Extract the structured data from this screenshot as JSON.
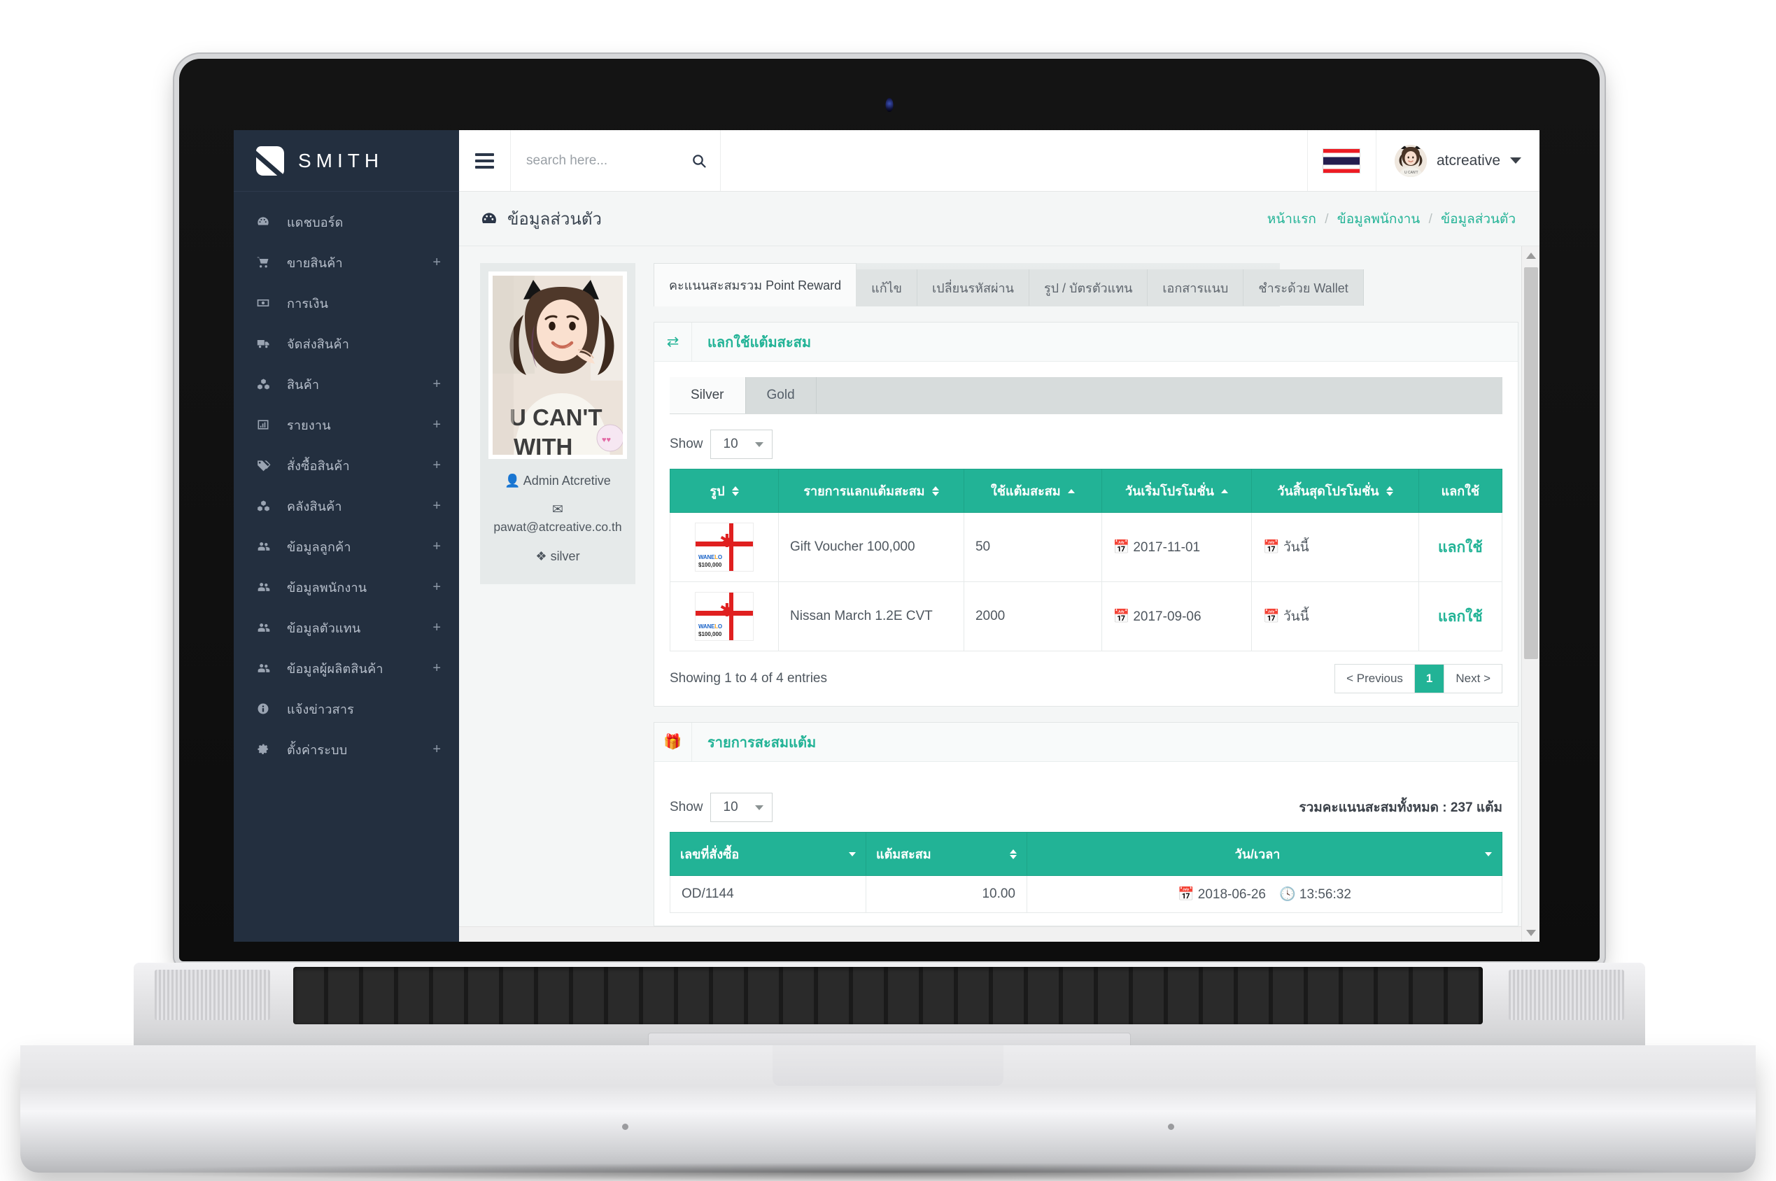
{
  "brand": {
    "name": "SMITH",
    "logo_icon": "smith-logo-icon"
  },
  "sidebar": {
    "items": [
      {
        "label": "แดชบอร์ด",
        "icon": "dashboard-icon",
        "expandable": false
      },
      {
        "label": "ขายสินค้า",
        "icon": "cart-icon",
        "expandable": true,
        "plus": "+"
      },
      {
        "label": "การเงิน",
        "icon": "money-icon",
        "expandable": false
      },
      {
        "label": "จัดส่งสินค้า",
        "icon": "truck-icon",
        "expandable": false
      },
      {
        "label": "สินค้า",
        "icon": "cubes-icon",
        "expandable": true,
        "plus": "+"
      },
      {
        "label": "รายงาน",
        "icon": "chart-bar-icon",
        "expandable": true,
        "plus": "+"
      },
      {
        "label": "สั่งซื้อสินค้า",
        "icon": "tags-icon",
        "expandable": true,
        "plus": "+"
      },
      {
        "label": "คลังสินค้า",
        "icon": "cubes-icon",
        "expandable": true,
        "plus": "+"
      },
      {
        "label": "ข้อมูลลูกค้า",
        "icon": "users-icon",
        "expandable": true,
        "plus": "+"
      },
      {
        "label": "ข้อมูลพนักงาน",
        "icon": "users-icon",
        "expandable": true,
        "plus": "+"
      },
      {
        "label": "ข้อมูลตัวแทน",
        "icon": "users-icon",
        "expandable": true,
        "plus": "+"
      },
      {
        "label": "ข้อมูลผู้ผลิตสินค้า",
        "icon": "users-icon",
        "expandable": true,
        "plus": "+"
      },
      {
        "label": "แจ้งข่าวสาร",
        "icon": "info-circle-icon",
        "expandable": false
      },
      {
        "label": "ตั้งค่าระบบ",
        "icon": "gear-icon",
        "expandable": true,
        "plus": "+"
      }
    ]
  },
  "topbar": {
    "hamburger_icon": "hamburger-icon",
    "search": {
      "placeholder": "search here...",
      "value": "",
      "icon": "search-icon"
    },
    "language_flag": "thailand-flag-icon",
    "user": {
      "name": "atcreative",
      "avatar_icon": "user-avatar",
      "caret_icon": "chevron-down-icon"
    }
  },
  "page": {
    "title": "ข้อมูลส่วนตัว",
    "title_icon": "dashboard-icon",
    "breadcrumb": [
      "หน้าแรก",
      "ข้อมูลพนักงาน",
      "ข้อมูลส่วนตัว"
    ],
    "breadcrumb_sep": "/"
  },
  "profile": {
    "photo_alt": "profile-photo",
    "name": "Admin Atcretive",
    "name_icon": "user-icon",
    "email": "pawat@atcreative.co.th",
    "email_icon": "envelope-icon",
    "rank": "silver",
    "rank_icon": "rank-icon"
  },
  "tabs": [
    {
      "label": "คะแนนสะสมรวม Point Reward",
      "active": true
    },
    {
      "label": "แก้ไข",
      "active": false
    },
    {
      "label": "เปลี่ยนรหัสผ่าน",
      "active": false
    },
    {
      "label": "รูป / บัตรตัวแทน",
      "active": false
    },
    {
      "label": "เอกสารแนบ",
      "active": false
    },
    {
      "label": "ชำระด้วย Wallet",
      "active": false
    }
  ],
  "redeem_panel": {
    "icon": "exchange-icon",
    "title": "แลกใช้แต้มสะสม",
    "subtabs": [
      {
        "label": "Silver",
        "active": true
      },
      {
        "label": "Gold",
        "active": false
      }
    ],
    "show_label": "Show",
    "show_value": "10",
    "columns": [
      {
        "label": "รูป",
        "sort": "both"
      },
      {
        "label": "รายการแลกแต้มสะสม",
        "sort": "both"
      },
      {
        "label": "ใช้แต้มสะสม",
        "sort": "up"
      },
      {
        "label": "วันเริ่มโปรโมชั่น",
        "sort": "up"
      },
      {
        "label": "วันสิ้นสุดโปรโมชั่น",
        "sort": "both"
      },
      {
        "label": "แลกใช้",
        "sort": "none"
      }
    ],
    "rows": [
      {
        "image_icon": "gift-voucher-thumb",
        "image_label_1": "WANELO",
        "image_label_2": "$100,000",
        "name": "Gift Voucher 100,000",
        "points": "50",
        "start_date": "2017-11-01",
        "end_date": "วันนี้",
        "action": "แลกใช้"
      },
      {
        "image_icon": "gift-voucher-thumb",
        "image_label_1": "WANELO",
        "image_label_2": "$100,000",
        "name": "Nissan March 1.2E CVT",
        "points": "2000",
        "start_date": "2017-09-06",
        "end_date": "วันนี้",
        "action": "แลกใช้"
      }
    ],
    "entries_info": "Showing 1 to 4 of 4 entries",
    "pagination": {
      "previous": "< Previous",
      "pages": [
        "1"
      ],
      "current": "1",
      "next": "Next >"
    }
  },
  "points_panel": {
    "icon": "gift-icon",
    "title": "รายการสะสมแต้ม",
    "show_label": "Show",
    "show_value": "10",
    "total_label": "รวมคะแนนสะสมทั้งหมด : 237 แต้ม",
    "columns": [
      {
        "label": "เลขที่สั่งซื้อ",
        "sort": "down"
      },
      {
        "label": "แต้มสะสม",
        "sort": "both"
      },
      {
        "label": "วัน/เวลา",
        "sort": "down"
      }
    ],
    "rows": [
      {
        "order_no": "OD/1144",
        "points": "10.00",
        "date": "2018-06-26",
        "time": "13:56:32"
      }
    ]
  },
  "colors": {
    "accent": "#22b396",
    "sidebar_bg": "#232f3f",
    "page_bg": "#f4f6f6",
    "flag_red": "#ED1C24",
    "flag_blue": "#241D4F"
  }
}
